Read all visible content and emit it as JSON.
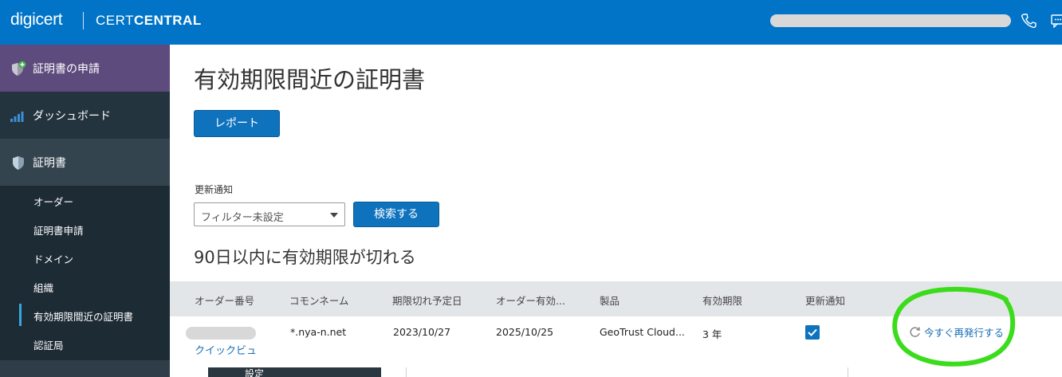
{
  "header": {
    "logo": "digicert",
    "product_prefix": "CERT",
    "product_bold": "CENTRAL"
  },
  "sidebar": {
    "request": "証明書の申請",
    "dashboard": "ダッシュボード",
    "certificates": "証明書",
    "sub_items": [
      "オーダー",
      "証明書申請",
      "ドメイン",
      "組織",
      "有効期限間近の証明書",
      "認証局"
    ]
  },
  "page": {
    "title": "有効期限間近の証明書",
    "report_button": "レポート",
    "filter_label": "更新通知",
    "filter_value": "フィルター未設定",
    "search_button": "検索する",
    "section_title": "90日以内に有効期限が切れる"
  },
  "table": {
    "headers": [
      "オーダー番号",
      "コモンネーム",
      "期限切れ予定日",
      "オーダー有効...",
      "製品",
      "有効期限",
      "更新通知"
    ],
    "row": {
      "common_name": "*.nya-n.net",
      "expiry_date": "2023/10/27",
      "order_valid": "2025/10/25",
      "product": "GeoTrust Cloud...",
      "validity": "3 年",
      "renewal_notice_checked": true,
      "quick_view": "クイックビュ",
      "reissue": "今すぐ再発行する"
    }
  },
  "bottom_menu": {
    "partial_text": "設定"
  },
  "colors": {
    "header": "#0174c8",
    "sidebar": "#1d2b35",
    "request_bg": "#5c4b7c",
    "primary_button": "#0f72bd",
    "annotation": "#3bdc1b"
  }
}
